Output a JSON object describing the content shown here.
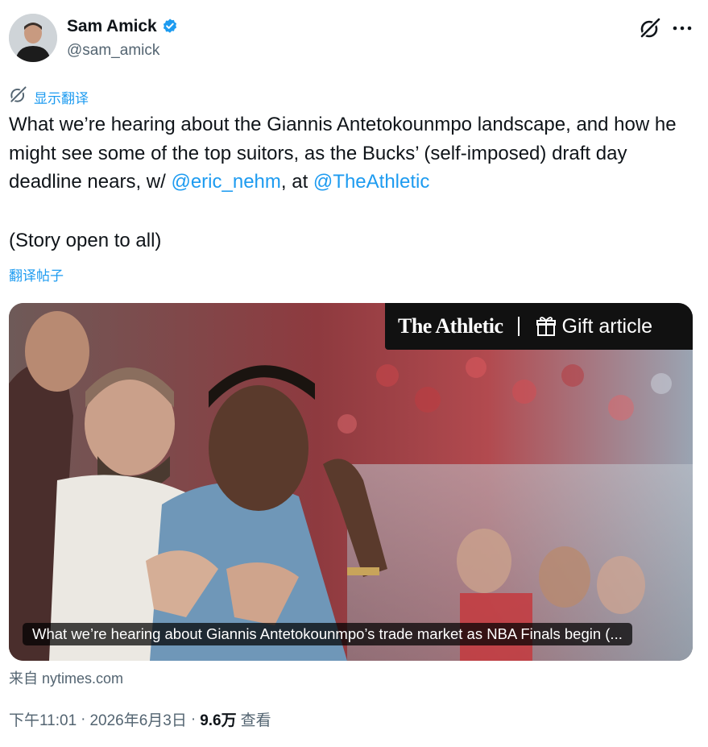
{
  "author": {
    "name": "Sam Amick",
    "handle": "@sam_amick",
    "verified": true,
    "verified_color": "#1d9bf0"
  },
  "icons": {
    "verified": "verified-badge-icon",
    "grok": "grok-icon",
    "more": "more-options-icon",
    "translate": "translate-icon",
    "gift": "gift-icon"
  },
  "show_translation_label": "显示翻译",
  "tweet": {
    "part1": "What we’re hearing about the Giannis Antetokounmpo landscape, and how he might see some of the top suitors, as the Bucks’ (self-imposed) draft day deadline nears, w/ ",
    "mention1": "@eric_nehm",
    "part2": ", at ",
    "mention2": "@TheAthletic",
    "story_line": "(Story open to all)"
  },
  "translate_post_label": "翻译帖子",
  "card": {
    "brand": "The Athletic",
    "gift_label": "Gift article",
    "caption": "What we’re hearing about Giannis Antetokounmpo’s trade market as NBA Finals begin (..."
  },
  "source_label": "来自 nytimes.com",
  "meta": {
    "time": "下午11:01",
    "separator1": "·",
    "date": "2026年6月3日",
    "separator2": "·",
    "views": "9.6万",
    "views_label": "查看"
  },
  "colors": {
    "link": "#1d9bf0",
    "secondary_text": "#536471",
    "primary_text": "#0f1419"
  }
}
